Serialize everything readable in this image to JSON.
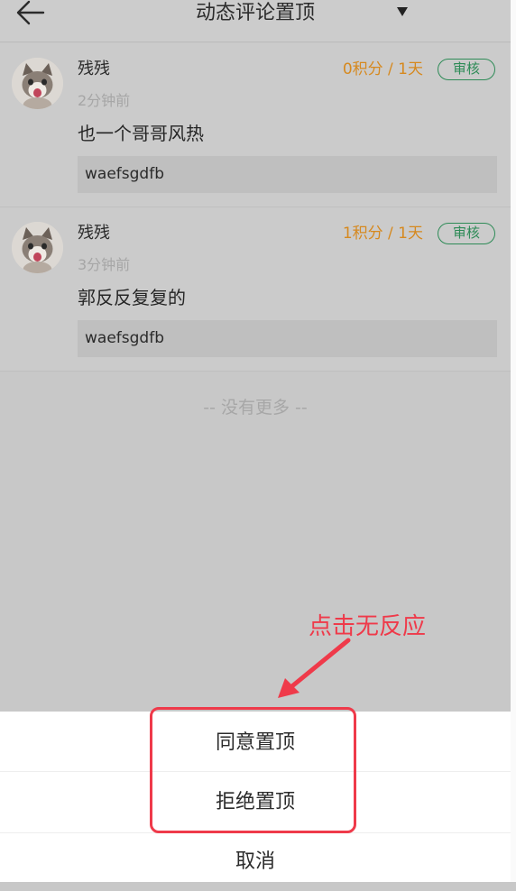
{
  "header": {
    "title": "动态评论置顶",
    "back_icon": "back-arrow-icon",
    "dropdown_icon": "triangle-down-icon"
  },
  "comments": [
    {
      "user_name": "残残",
      "time": "2分钟前",
      "content": "也一个哥哥风热",
      "reply": "waefsgdfb",
      "points": "0积分 / 1天",
      "audit_label": "审核"
    },
    {
      "user_name": "残残",
      "time": "3分钟前",
      "content": "郭反反复复的",
      "reply": "waefsgdfb",
      "points": "1积分 / 1天",
      "audit_label": "审核"
    }
  ],
  "no_more_text": "-- 没有更多 --",
  "annotation": {
    "text": "点击无反应",
    "color": "#ef3a4a"
  },
  "action_sheet": {
    "agree_label": "同意置顶",
    "reject_label": "拒绝置顶",
    "cancel_label": "取消"
  },
  "colors": {
    "points": "#d6891f",
    "audit": "#2e8b57",
    "overlay_bg": "#c8c8c8"
  }
}
